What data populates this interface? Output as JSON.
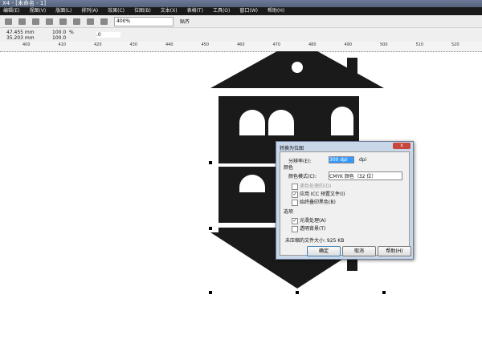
{
  "title": "X4 - [未命名 - 1]",
  "menu": [
    "编辑(E)",
    "视图(V)",
    "版面(L)",
    "排列(A)",
    "效果(C)",
    "位图(B)",
    "文本(X)",
    "表格(T)",
    "工具(O)",
    "窗口(W)",
    "帮助(H)"
  ],
  "toolbar": {
    "zoom": "400%",
    "snap": "贴齐"
  },
  "propbar": {
    "width": "47.455 mm",
    "height": "35.203 mm",
    "scale_x": "100.0",
    "scale_y": "100.0",
    "unit": "%",
    "rotation": ".0"
  },
  "ruler": [
    "400",
    "410",
    "420",
    "430",
    "440",
    "450",
    "460",
    "470",
    "480",
    "490",
    "500",
    "510",
    "520"
  ],
  "dialog": {
    "title": "转换为位图",
    "resolution_label": "分辨率(E):",
    "resolution": "300 dpi",
    "resolution_unit": "dpi",
    "color_group": "颜色",
    "color_mode_label": "颜色模式(C):",
    "color_mode": "CMYK 颜色（32 位）",
    "dither": "递色处理的(D)",
    "icc": "应用 ICC 预置文件(I)",
    "overprint": "始终叠印黑色(B)",
    "options_group": "选项",
    "antialias": "光滑处理(A)",
    "transparent": "透明背景(T)",
    "filesize": "未压缩的文件大小: 925 KB",
    "ok": "确定",
    "cancel": "取消",
    "help": "帮助(H)",
    "checked": {
      "dither": false,
      "icc": true,
      "overprint": false,
      "antialias": true,
      "transparent": false
    }
  }
}
